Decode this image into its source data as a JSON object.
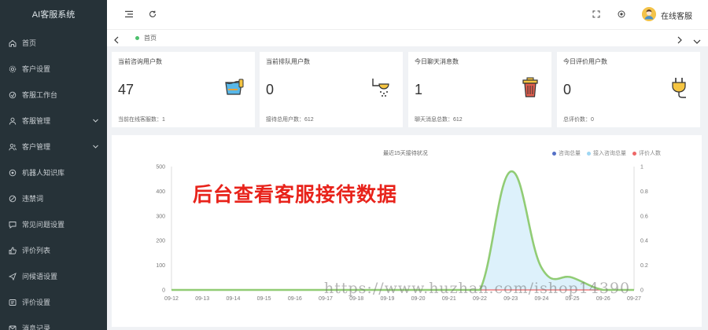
{
  "brand": "AI客服系统",
  "sidebar": {
    "items": [
      {
        "label": "首页",
        "icon": "home-icon",
        "expandable": false
      },
      {
        "label": "客户设置",
        "icon": "gear-icon",
        "expandable": false
      },
      {
        "label": "客服工作台",
        "icon": "workbench-icon",
        "expandable": false
      },
      {
        "label": "客服管理",
        "icon": "user-icon",
        "expandable": true
      },
      {
        "label": "客户管理",
        "icon": "users-icon",
        "expandable": true
      },
      {
        "label": "机器人知识库",
        "icon": "robot-icon",
        "expandable": false
      },
      {
        "label": "违禁词",
        "icon": "forbidden-icon",
        "expandable": false
      },
      {
        "label": "常见问题设置",
        "icon": "question-icon",
        "expandable": false
      },
      {
        "label": "评价列表",
        "icon": "thumb-icon",
        "expandable": false
      },
      {
        "label": "问候语设置",
        "icon": "send-icon",
        "expandable": false
      },
      {
        "label": "评价设置",
        "icon": "setting-icon",
        "expandable": false
      },
      {
        "label": "消息记录",
        "icon": "message-icon",
        "expandable": false
      }
    ]
  },
  "header": {
    "username": "在线客服"
  },
  "tabs": {
    "home_label": "首页"
  },
  "cards": [
    {
      "title": "当前咨询用户数",
      "value": "47",
      "footer": "当前在线客服数：1",
      "icon": "paint-bucket-icon"
    },
    {
      "title": "当前排队用户数",
      "value": "0",
      "footer": "接待总用户数：612",
      "icon": "shower-icon"
    },
    {
      "title": "今日聊天消息数",
      "value": "1",
      "footer": "聊天消息总数：612",
      "icon": "trash-can-icon"
    },
    {
      "title": "今日评价用户数",
      "value": "0",
      "footer": "总评价数：0",
      "icon": "plug-icon"
    }
  ],
  "chart_data": {
    "type": "line",
    "title": "最近15天接待状况",
    "categories": [
      "09-12",
      "09-13",
      "09-14",
      "09-15",
      "09-16",
      "09-17",
      "09-18",
      "09-19",
      "09-20",
      "09-21",
      "09-22",
      "09-23",
      "09-24",
      "09-25",
      "09-26",
      "09-27"
    ],
    "series": [
      {
        "name": "咨询总量",
        "color": "#5470c6",
        "values": [
          0,
          0,
          0,
          0,
          0,
          0,
          0,
          0,
          0,
          0,
          0,
          480,
          90,
          50,
          0,
          0
        ]
      },
      {
        "name": "接入咨询总量",
        "color": "#91cc75",
        "values": [
          0,
          0,
          0,
          0,
          0,
          0,
          0,
          0,
          0,
          0,
          0,
          480,
          90,
          50,
          0,
          0
        ]
      },
      {
        "name": "评价人数",
        "color": "#ee6666",
        "values": [
          0,
          0,
          0,
          0,
          0,
          0,
          0,
          0,
          0,
          0,
          0,
          0,
          0,
          0,
          0,
          0
        ]
      }
    ],
    "left_axis": {
      "ticks": [
        "0",
        "100",
        "200",
        "300",
        "400",
        "500"
      ],
      "ylim": [
        0,
        500
      ]
    },
    "right_axis": {
      "ticks": [
        "0",
        "0.2",
        "0.4",
        "0.6",
        "0.8",
        "1"
      ],
      "ylim": [
        0,
        1
      ]
    },
    "legend_position": "top-right"
  },
  "overlay_text": "后台查看客服接待数据",
  "watermark": "https://www.huzhan.com/ishop14390",
  "colors": {
    "sidebar_bg": "#263238",
    "accent_green": "#4cc06c",
    "overlay_red": "#e8231b"
  }
}
